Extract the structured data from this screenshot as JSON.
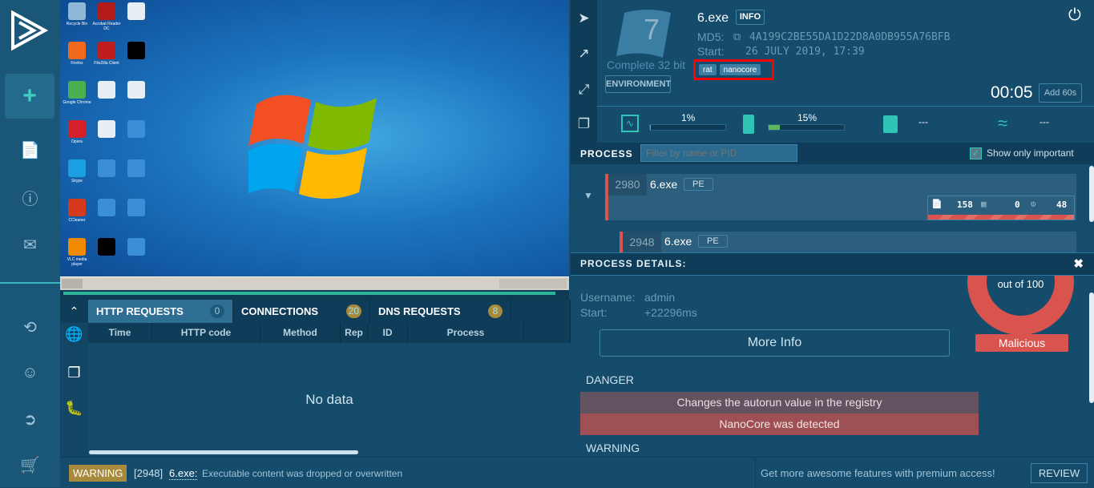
{
  "sidebar": {
    "items": [
      "new-task",
      "reports",
      "help",
      "contact",
      "history",
      "profile",
      "logout",
      "pricing"
    ]
  },
  "desktop": {
    "icons": [
      {
        "label": "Recycle Bin",
        "color": "#8fb7d6"
      },
      {
        "label": "Acrobat Reader DC",
        "color": "#b31b1b"
      },
      {
        "label": "",
        "color": "#e8eef5"
      },
      {
        "label": "Firefox",
        "color": "#f06a1d"
      },
      {
        "label": "FileZilla Client",
        "color": "#bf1e1e"
      },
      {
        "label": "",
        "color": "#000000"
      },
      {
        "label": "Google Chrome",
        "color": "#4caf50"
      },
      {
        "label": "",
        "color": "#e8eef5"
      },
      {
        "label": "",
        "color": "#e8eef5"
      },
      {
        "label": "Opera",
        "color": "#d4202a"
      },
      {
        "label": "",
        "color": "#e8eef5"
      },
      {
        "label": "",
        "color": "#3b8fd6"
      },
      {
        "label": "Skype",
        "color": "#1aa0e0"
      },
      {
        "label": "",
        "color": "#3b8fd6"
      },
      {
        "label": "",
        "color": "#3b8fd6"
      },
      {
        "label": "CCleaner",
        "color": "#d63a1e"
      },
      {
        "label": "",
        "color": "#3b8fd6"
      },
      {
        "label": "",
        "color": "#3b8fd6"
      },
      {
        "label": "VLC media player",
        "color": "#f08a00"
      },
      {
        "label": "",
        "color": "#000000"
      },
      {
        "label": "",
        "color": "#3b8fd6"
      }
    ]
  },
  "network": {
    "tabs": [
      {
        "label": "HTTP REQUESTS",
        "count": "0"
      },
      {
        "label": "CONNECTIONS",
        "count": "20"
      },
      {
        "label": "DNS REQUESTS",
        "count": "8"
      }
    ],
    "columns": [
      "Time",
      "HTTP code",
      "Method",
      "Rep",
      "ID",
      "Process"
    ],
    "empty": "No data"
  },
  "task": {
    "name": "6.exe",
    "info": "INFO",
    "md5_label": "MD5:",
    "md5": "4A199C2BE55DA1D22D8A0DB955A76BFB",
    "start_label": "Start:",
    "start": "26 JULY 2019, 17:39",
    "tags": [
      "rat",
      "nanocore"
    ],
    "os_version": "7",
    "os": "Complete 32 bit",
    "env_button": "ENVIRONMENT",
    "timer": "00:05",
    "add_time": "Add 60s"
  },
  "stats": {
    "cpu": "1%",
    "cpu_value": 1,
    "ram": "15%",
    "ram_value": 15,
    "disk": "---",
    "net": "---"
  },
  "process": {
    "title": "PROCESS",
    "filter_placeholder": "Filter by name or PID",
    "show_important": "Show only important",
    "items": [
      {
        "pid": "2980",
        "name": "6.exe",
        "type": "PE",
        "files": "158",
        "registry": "0",
        "modules": "48"
      },
      {
        "pid": "2948",
        "name": "6.exe",
        "type": "PE"
      }
    ]
  },
  "details": {
    "title": "PROCESS DETAILS:",
    "username_label": "Username:",
    "username": "admin",
    "start_label": "Start:",
    "start": "+22296ms",
    "score_label": "out of 100",
    "verdict": "Malicious",
    "more_info": "More Info",
    "danger_title": "DANGER",
    "danger": [
      "Changes the autorun value in the registry",
      "NanoCore was detected"
    ],
    "warning_title": "WARNING"
  },
  "statusbar": {
    "level": "WARNING",
    "pid": "[2948]",
    "process": "6.exe:",
    "message": "Executable content was dropped or overwritten",
    "promo": "Get more awesome features with premium access!",
    "review": "REVIEW"
  },
  "colors": {
    "accent": "#3fd0c0",
    "danger": "#d9534f",
    "warning": "#a88a3c"
  }
}
